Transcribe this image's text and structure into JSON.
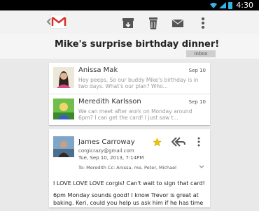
{
  "status_bar": {
    "time": "4:30"
  },
  "app": {
    "subject": "Mike's surprise birthday dinner!",
    "label_chip": "Inbox"
  },
  "messages": [
    {
      "sender": "Anissa Mak",
      "date": "Sep 10",
      "snippet": "Hey peeps, So our buddy Mike's birthday is in two days. What's our plan? Who...",
      "avatar": "anissa-avatar"
    },
    {
      "sender": "Meredith Karlsson",
      "date": "Sep 10",
      "snippet": "We can meet after work on Monday around 6pm? I can get the card! I just saw t...",
      "avatar": "meredith-avatar"
    }
  ],
  "open_message": {
    "sender": "James Carroway",
    "email": "corgicrazy@gmail.com",
    "datetime": "Tue, Sep 10, 2013, 7:14PM",
    "recipients": "To: Meredith  Cc: Anissa, me, Peter, Michael",
    "body": [
      "I LOVE LOVE LOVE corgis! Can't wait to sign that card!",
      "6pm Monday sounds good! I know Trevor is great at baking. Keri, could you help us ask him if he has time"
    ]
  },
  "icons": {
    "up": "chevron-left-icon",
    "app_logo": "gmail-logo-icon",
    "archive": "archive-icon",
    "delete": "trash-icon",
    "mark_unread": "envelope-icon",
    "overflow": "overflow-menu-icon",
    "star": "star-icon",
    "reply_all": "reply-all-icon"
  },
  "colors": {
    "accent": "#33b5e5",
    "star": "#f2c200",
    "gmail_red": "#d93025"
  }
}
